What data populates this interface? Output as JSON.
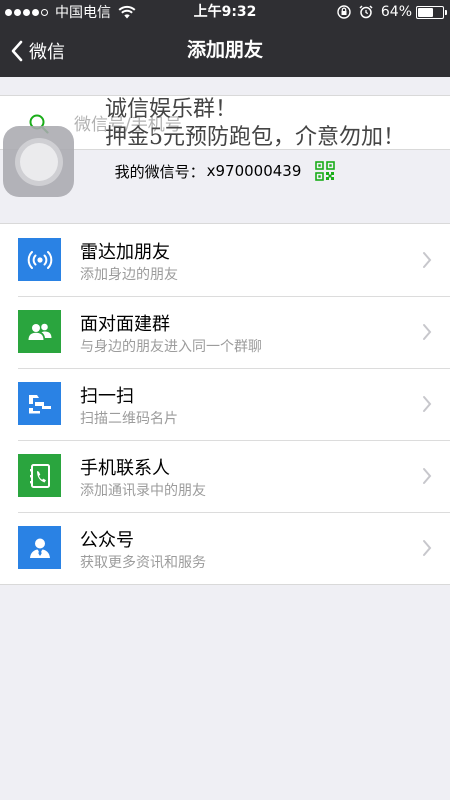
{
  "status_bar": {
    "carrier": "中国电信",
    "time": "上午9:32",
    "battery": "64%",
    "battery_level": 0.64
  },
  "nav": {
    "back_label": "微信",
    "title": "添加朋友"
  },
  "search": {
    "placeholder": "微信号/手机号"
  },
  "my_id": {
    "label": "我的微信号：",
    "value": "x970000439"
  },
  "overlay": {
    "line1": "诚信娱乐群！",
    "line2": "押金5元预防跑包，介意勿加！"
  },
  "menu": [
    {
      "title": "雷达加朋友",
      "subtitle": "添加身边的朋友",
      "icon": "radar-icon",
      "color": "#2a82e4"
    },
    {
      "title": "面对面建群",
      "subtitle": "与身边的朋友进入同一个群聊",
      "icon": "group-icon",
      "color": "#2aa53e"
    },
    {
      "title": "扫一扫",
      "subtitle": "扫描二维码名片",
      "icon": "scan-icon",
      "color": "#2a82e4"
    },
    {
      "title": "手机联系人",
      "subtitle": "添加通讯录中的朋友",
      "icon": "phone-contacts-icon",
      "color": "#2aa53e"
    },
    {
      "title": "公众号",
      "subtitle": "获取更多资讯和服务",
      "icon": "official-account-icon",
      "color": "#2a82e4"
    }
  ],
  "colors": {
    "nav_bg": "#2f2f33",
    "page_bg": "#efeff4",
    "qr_green": "#1aad19"
  }
}
